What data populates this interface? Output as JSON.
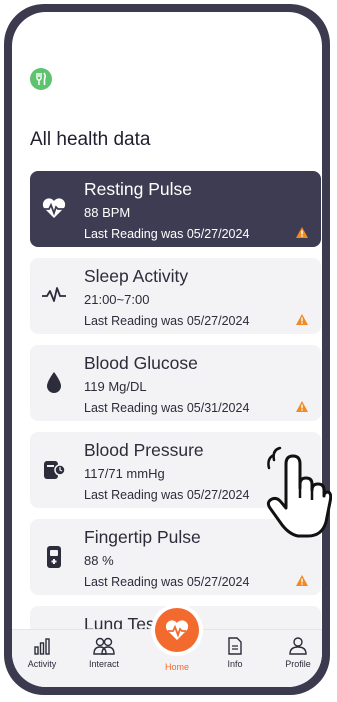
{
  "page": {
    "title": "All health data"
  },
  "cards": [
    {
      "name": "Resting Pulse",
      "value": "88 BPM",
      "last": "Last Reading was 05/27/2024",
      "icon": "heart-pulse-icon",
      "warning": true,
      "active": true
    },
    {
      "name": "Sleep Activity",
      "value": "21:00~7:00",
      "last": "Last Reading was 05/27/2024",
      "icon": "activity-wave-icon",
      "warning": true,
      "active": false
    },
    {
      "name": "Blood Glucose",
      "value": "119 Mg/DL",
      "last": "Last Reading was 05/31/2024",
      "icon": "blood-drop-icon",
      "warning": true,
      "active": false
    },
    {
      "name": "Blood Pressure",
      "value": "117/71 mmHg",
      "last": "Last Reading was 05/27/2024",
      "icon": "blood-pressure-monitor-icon",
      "warning": false,
      "active": false
    },
    {
      "name": "Fingertip Pulse",
      "value": "88 %",
      "last": "Last Reading was 05/27/2024",
      "icon": "pulse-oximeter-icon",
      "warning": true,
      "active": false
    },
    {
      "name": "Lung Test",
      "value": "",
      "last": "",
      "icon": "lungs-icon",
      "warning": false,
      "active": false
    }
  ],
  "nav": {
    "items": [
      {
        "label": "Activity",
        "icon": "bar-chart-icon"
      },
      {
        "label": "Interact",
        "icon": "users-icon"
      },
      {
        "label": "Home",
        "icon": "heart-pulse-icon",
        "active": true
      },
      {
        "label": "Info",
        "icon": "document-icon"
      },
      {
        "label": "Profile",
        "icon": "person-icon"
      }
    ]
  },
  "colors": {
    "frame": "#3b3a4e",
    "active_card": "#3e3c52",
    "card": "#f3f3f6",
    "accent": "#f26a2e",
    "warning": "#f08a24",
    "logo": "#5ec36e"
  }
}
